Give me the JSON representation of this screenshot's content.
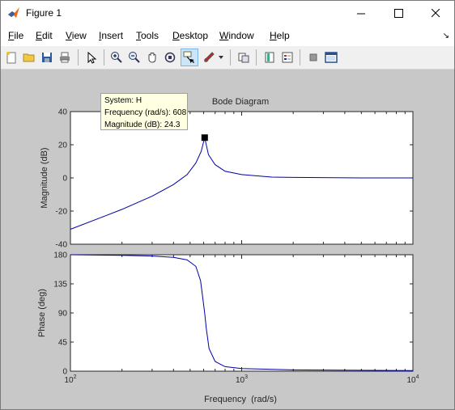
{
  "window": {
    "title": "Figure 1",
    "controls": [
      "minimize",
      "maximize",
      "close"
    ]
  },
  "menubar": {
    "items": [
      {
        "label": "File",
        "accel": "F"
      },
      {
        "label": "Edit",
        "accel": "E"
      },
      {
        "label": "View",
        "accel": "V"
      },
      {
        "label": "Insert",
        "accel": "I"
      },
      {
        "label": "Tools",
        "accel": "T"
      },
      {
        "label": "Desktop",
        "accel": "D"
      },
      {
        "label": "Window",
        "accel": "W"
      },
      {
        "label": "Help",
        "accel": "H"
      }
    ]
  },
  "toolbar": {
    "buttons": [
      "new-figure-icon",
      "open-file-icon",
      "save-icon",
      "print-icon",
      "edit-plot-arrow-icon",
      "zoom-in-icon",
      "zoom-out-icon",
      "pan-hand-icon",
      "rotate-3d-icon",
      "data-cursor-icon",
      "brush-icon",
      "link-plot-icon",
      "colorbar-icon",
      "legend-icon",
      "hide-plot-tools-icon",
      "show-plot-tools-icon"
    ],
    "active": "data-cursor-icon"
  },
  "datatip": {
    "system": "System: H",
    "frequency": "Frequency (rad/s): 608",
    "magnitude": "Magnitude (dB): 24.3"
  },
  "chart_data": {
    "type": "line",
    "title": "Bode Diagram",
    "xlabel": "Frequency  (rad/s)",
    "xscale": "log",
    "xlim": [
      100,
      10000
    ],
    "xticks": [
      "10^2",
      "10^3",
      "10^4"
    ],
    "line_color": "#0000aa",
    "subplots": [
      {
        "name": "magnitude",
        "ylabel": "Magnitude (dB)",
        "ylim": [
          -40,
          40
        ],
        "yticks": [
          "40",
          "20",
          "0",
          "-20",
          "-40"
        ],
        "x": [
          100,
          150,
          200,
          300,
          400,
          480,
          540,
          580,
          608,
          640,
          700,
          800,
          1000,
          1500,
          2000,
          5000,
          10000
        ],
        "y": [
          -31,
          -24,
          -19,
          -11,
          -4,
          2,
          9,
          16,
          24.3,
          14,
          8,
          4,
          2,
          0.5,
          0.3,
          0,
          0
        ]
      },
      {
        "name": "phase",
        "ylabel": "Phase (deg)",
        "ylim": [
          0,
          180
        ],
        "yticks": [
          "180",
          "135",
          "90",
          "45",
          "0"
        ],
        "x": [
          100,
          200,
          300,
          400,
          480,
          540,
          575,
          595,
          608,
          622,
          645,
          700,
          800,
          1000,
          2000,
          10000
        ],
        "y": [
          180,
          179,
          178,
          176,
          172,
          162,
          140,
          110,
          90,
          65,
          35,
          15,
          7,
          4,
          2,
          1
        ]
      }
    ],
    "marker": {
      "x": 608,
      "y": 24.3,
      "subplot": "magnitude"
    },
    "grid": false
  }
}
